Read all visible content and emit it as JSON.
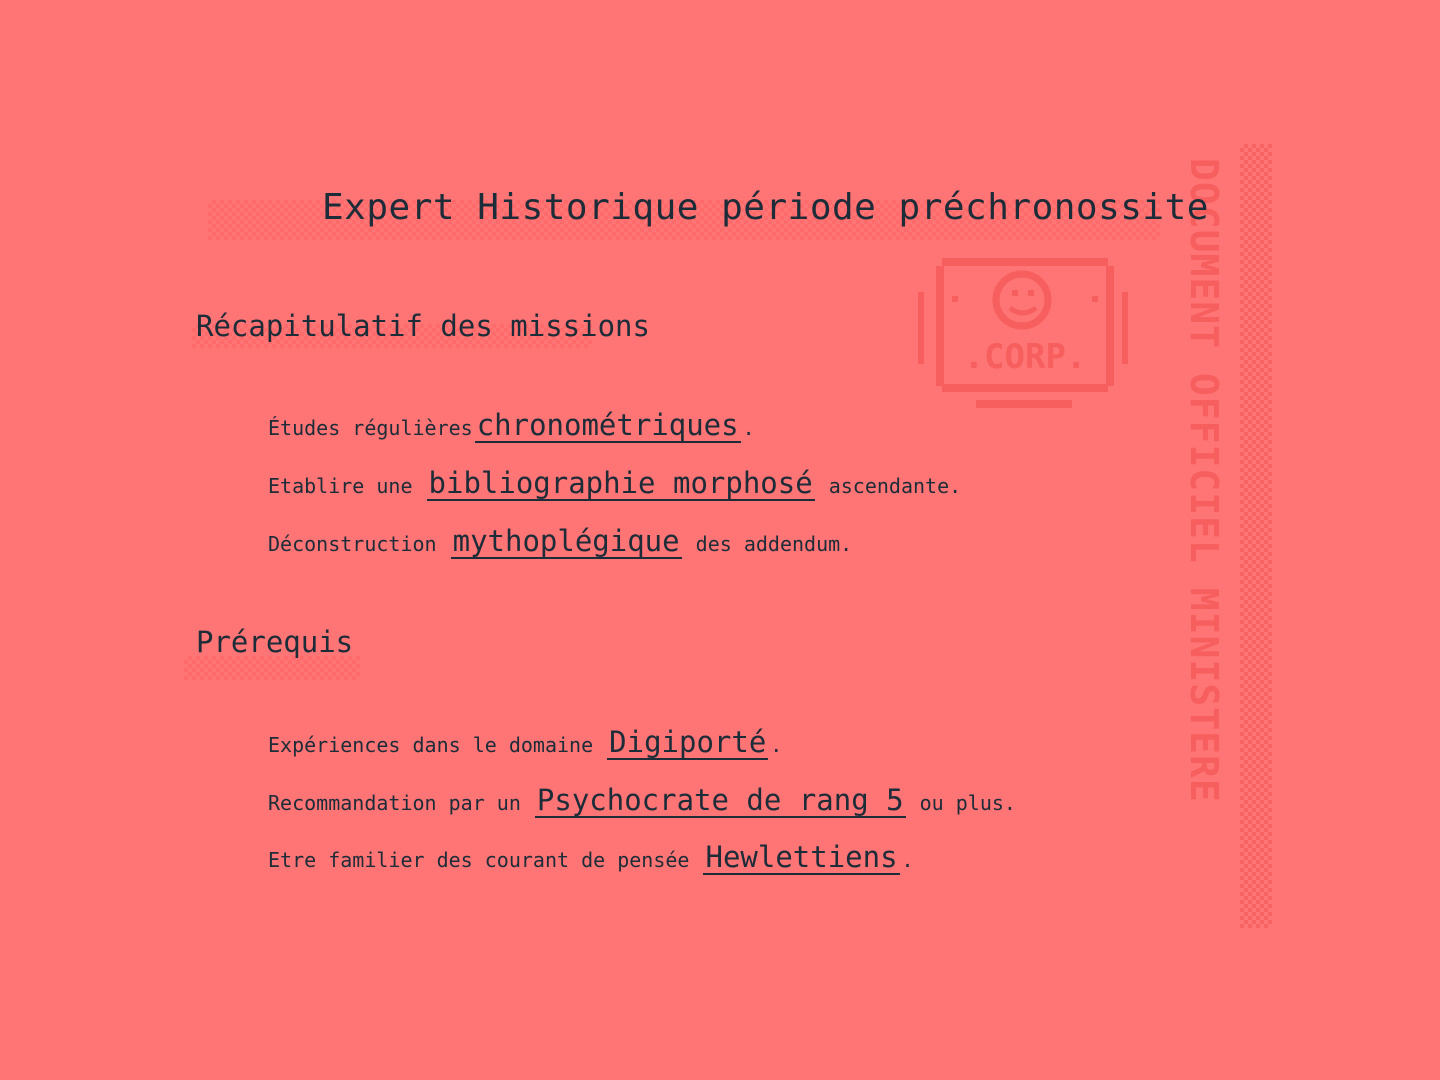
{
  "document": {
    "title": "Expert Historique période préchronossite",
    "vertical_stamp": "DOCUMENT OFFICIEL MINISTERE",
    "logo_text": ".CORP."
  },
  "sections": [
    {
      "heading": "Récapitulatif des missions",
      "items": [
        {
          "before": "Études régulières",
          "keyword": "chronométriques",
          "after": "."
        },
        {
          "before": "Etablire une",
          "keyword": "bibliographie morphosé",
          "after": "ascendante."
        },
        {
          "before": "Déconstruction",
          "keyword": "mythoplégique",
          "after": "des addendum."
        }
      ]
    },
    {
      "heading": "Prérequis",
      "items": [
        {
          "before": "Expériences dans le domaine",
          "keyword": "Digiporté",
          "after": "."
        },
        {
          "before": "Recommandation par un",
          "keyword": "Psychocrate de rang 5",
          "after": "ou plus."
        },
        {
          "before": "Etre familier des courant de pensée",
          "keyword": "Hewlettiens",
          "after": "."
        }
      ]
    }
  ],
  "colors": {
    "background": "#ff7474",
    "text": "#1c2c38",
    "stamp": "#f75e5e"
  }
}
